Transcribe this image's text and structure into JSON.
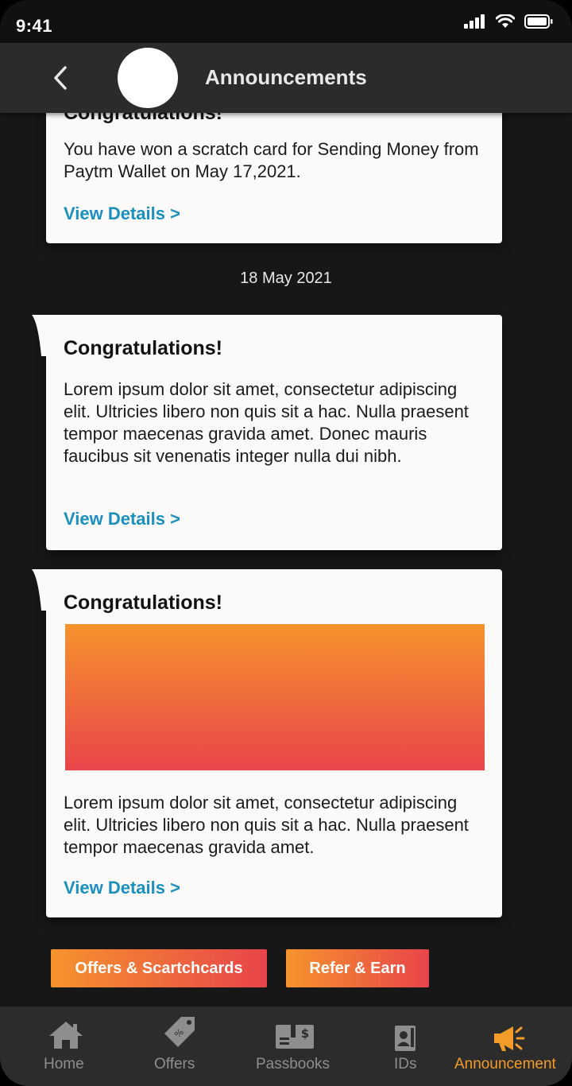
{
  "status_bar": {
    "time": "9:41"
  },
  "header": {
    "title": "Announcements"
  },
  "cards": [
    {
      "title": "Congratulations!",
      "body": "You have won a scratch card for Sending Money from Paytm Wallet on May 17,2021.",
      "link": "View Details >"
    },
    {
      "title": "Congratulations!",
      "body": "Lorem ipsum dolor sit amet, consectetur adipiscing elit. Ultricies libero non quis sit a hac. Nulla praesent tempor maecenas gravida amet. Donec mauris faucibus sit venenatis integer nulla dui nibh.",
      "link": "View Details >"
    },
    {
      "title": "Congratulations!",
      "body": "Lorem ipsum dolor sit amet, consectetur adipiscing elit. Ultricies libero non quis sit a hac. Nulla praesent tempor maecenas gravida amet.",
      "link": "View Details >"
    }
  ],
  "date_separator": "18 May 2021",
  "actions": {
    "offers_label": "Offers & Scartchcards",
    "refer_label": "Refer & Earn"
  },
  "bottom_nav": {
    "items": [
      {
        "label": "Home",
        "icon": "home-icon"
      },
      {
        "label": "Offers",
        "icon": "tag-icon"
      },
      {
        "label": "Passbooks",
        "icon": "passbook-icon"
      },
      {
        "label": "IDs",
        "icon": "id-card-icon"
      },
      {
        "label": "Announcement",
        "icon": "megaphone-icon"
      }
    ],
    "active": "Announcement"
  },
  "colors": {
    "accent_orange": "#f6932d",
    "accent_red": "#e8444a",
    "link_blue": "#1a8fc0",
    "background": "#171717"
  }
}
